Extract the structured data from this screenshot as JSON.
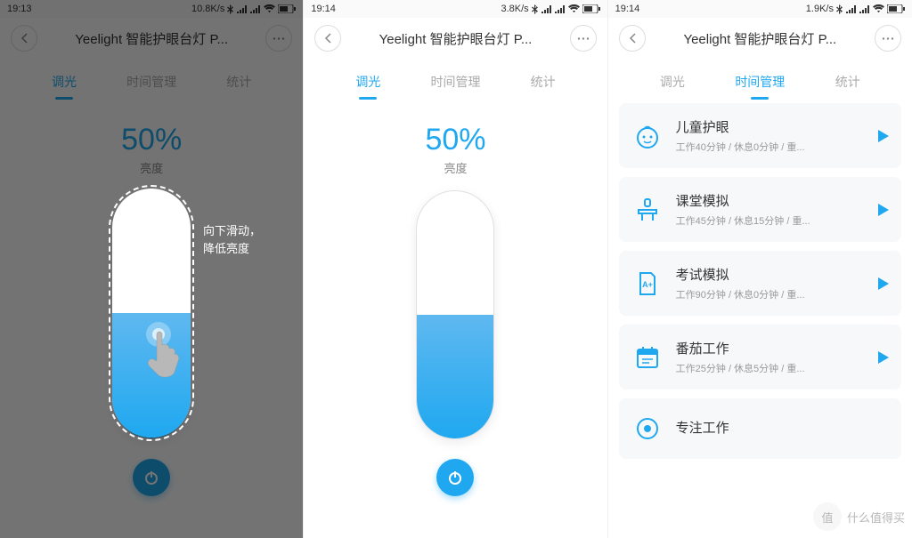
{
  "status": {
    "time1": "19:13",
    "time2": "19:14",
    "time3": "19:14",
    "net1": "10.8K/s",
    "net2": "3.8K/s",
    "net3": "1.9K/s"
  },
  "header": {
    "title": "Yeelight 智能护眼台灯 P..."
  },
  "tabs": {
    "dimming": "调光",
    "time_mgmt": "时间管理",
    "stats": "统计"
  },
  "brightness": {
    "value": "50%",
    "label": "亮度"
  },
  "tutorial": {
    "line1": "向下滑动，",
    "line2": "降低亮度"
  },
  "modes": [
    {
      "title": "儿童护眼",
      "sub": "工作40分钟 / 休息0分钟 / 重..."
    },
    {
      "title": "课堂模拟",
      "sub": "工作45分钟 / 休息15分钟 / 重..."
    },
    {
      "title": "考试模拟",
      "sub": "工作90分钟 / 休息0分钟 / 重..."
    },
    {
      "title": "番茄工作",
      "sub": "工作25分钟 / 休息5分钟 / 重..."
    },
    {
      "title": "专注工作",
      "sub": ""
    }
  ],
  "watermark": {
    "circle": "值",
    "text": "什么值得买"
  }
}
